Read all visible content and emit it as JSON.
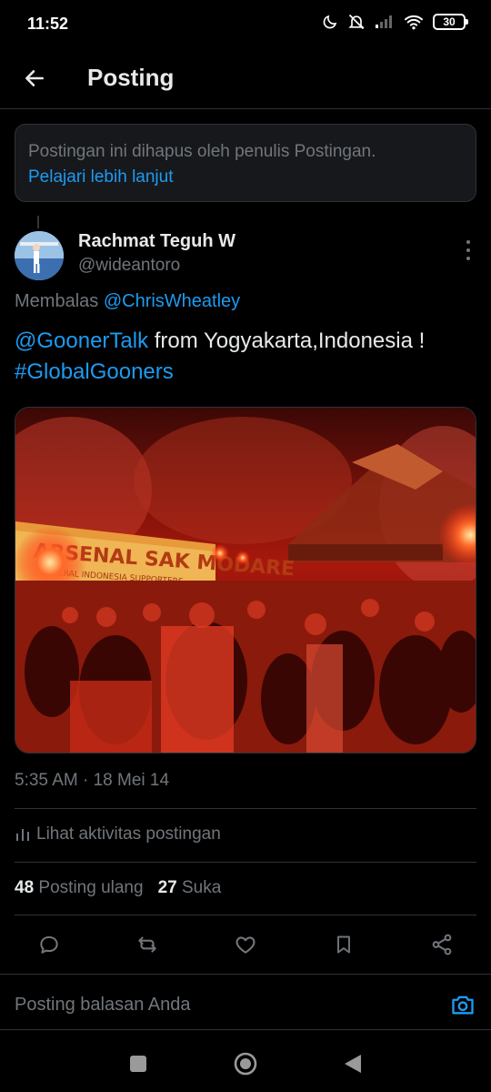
{
  "status_bar": {
    "time": "11:52",
    "battery": "30"
  },
  "header": {
    "title": "Posting"
  },
  "deleted_notice": {
    "text": "Postingan ini dihapus oleh penulis Postingan.",
    "link": "Pelajari lebih lanjut"
  },
  "post": {
    "author_name": "Rachmat Teguh W",
    "author_handle": "@wideantoro",
    "reply_prefix": "Membalas",
    "reply_mention": "@ChrisWheatley",
    "text_mention": "@GoonerTalk",
    "text_body": " from Yogyakarta,Indonesia !",
    "text_hashtag": "#GlobalGooners",
    "banner_text": "ARSENAL SAK MODARE",
    "banner_subtext": "GERAL INDONESIA SUPPORTERS",
    "timestamp": "5:35 AM · 18 Mei 14",
    "analytics_label": "Lihat aktivitas postingan",
    "reposts_count": "48",
    "reposts_label": "Posting ulang",
    "likes_count": "27",
    "likes_label": "Suka"
  },
  "reply_bar": {
    "placeholder": "Posting balasan Anda"
  },
  "icons": {
    "back": "arrow-left-icon",
    "more": "more-vertical-icon",
    "analytics": "bar-chart-icon",
    "reply": "comment-icon",
    "repost": "repost-icon",
    "like": "heart-icon",
    "bookmark": "bookmark-icon",
    "share": "share-icon",
    "camera": "camera-icon"
  },
  "colors": {
    "background": "#000000",
    "accent": "#1d9bf0",
    "muted": "#71767b",
    "text": "#e7e9ea"
  }
}
